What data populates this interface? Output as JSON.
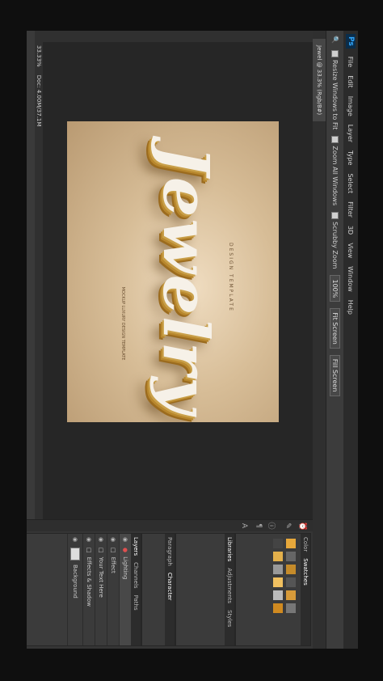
{
  "app": {
    "logo": "Ps",
    "menu": [
      "File",
      "Edit",
      "Image",
      "Layer",
      "Type",
      "Select",
      "Filter",
      "3D",
      "View",
      "Window",
      "Help"
    ]
  },
  "options_bar": {
    "items": [
      "Resize Windows to Fit",
      "Zoom All Windows",
      "Scrubby Zoom",
      "100%",
      "Fit Screen",
      "Fill Screen"
    ]
  },
  "document": {
    "tab_label": "Jewel @ 33.3% (Rgb/8#)",
    "zoom": "33.33%",
    "status": "Doc: 4.00M/37.1M"
  },
  "artwork": {
    "headline": "Jewelry",
    "subtitle": "DESIGN TEMPLATE",
    "caption": "MOCKUP LUXURY DESIGN TEMPLATE"
  },
  "panels": {
    "swatch_tabs": [
      "Color",
      "Swatches"
    ],
    "props_tabs": [
      "Libraries",
      "Adjustments",
      "Styles"
    ],
    "adj_tabs": [
      "Paragraph",
      "Character"
    ],
    "layers_tabs": [
      "Layers",
      "Channels",
      "Paths"
    ],
    "layers": [
      {
        "name": "Lighting"
      },
      {
        "name": "Effect"
      },
      {
        "name": "Your Text Here"
      },
      {
        "name": "Effects & Shadow"
      },
      {
        "name": "Background"
      }
    ]
  },
  "colors": {
    "accent": "#31a8ff",
    "fx_red": "#e05050",
    "gold": "#b8872d"
  }
}
